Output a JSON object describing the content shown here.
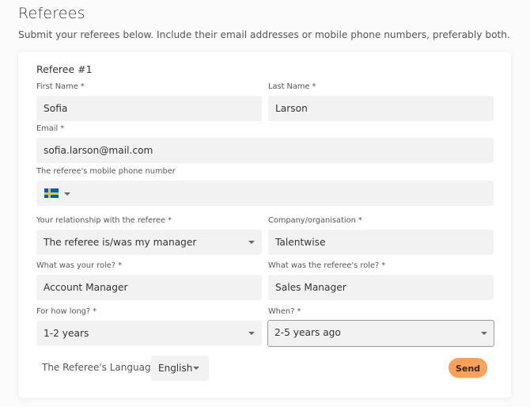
{
  "page": {
    "title": "Referees",
    "subtitle": "Submit your referees below. Include their email addresses or mobile phone numbers, preferably both."
  },
  "referee": {
    "heading": "Referee #1",
    "first_name": {
      "label": "First Name *",
      "value": "Sofia"
    },
    "last_name": {
      "label": "Last Name *",
      "value": "Larson"
    },
    "email": {
      "label": "Email *",
      "value": "sofia.larson@mail.com"
    },
    "phone": {
      "label": "The referee's mobile phone number",
      "value": "",
      "country_flag": "sweden-flag-icon"
    },
    "relationship": {
      "label": "Your relationship with the referee *",
      "value": "The referee is/was my manager"
    },
    "company": {
      "label": "Company/organisation *",
      "value": "Talentwise"
    },
    "your_role": {
      "label": "What was your role? *",
      "value": "Account Manager"
    },
    "referee_role": {
      "label": "What was the referee's role? *",
      "value": "Sales Manager"
    },
    "duration": {
      "label": "For how long? *",
      "value": "1-2 years"
    },
    "when": {
      "label": "When? *",
      "value": "2-5 years ago"
    }
  },
  "language": {
    "label": "The Referee's Language",
    "value": "English"
  },
  "actions": {
    "send_label": "Send"
  },
  "colors": {
    "accent": "#f9a05a",
    "field_bg": "#f2f2f2"
  }
}
